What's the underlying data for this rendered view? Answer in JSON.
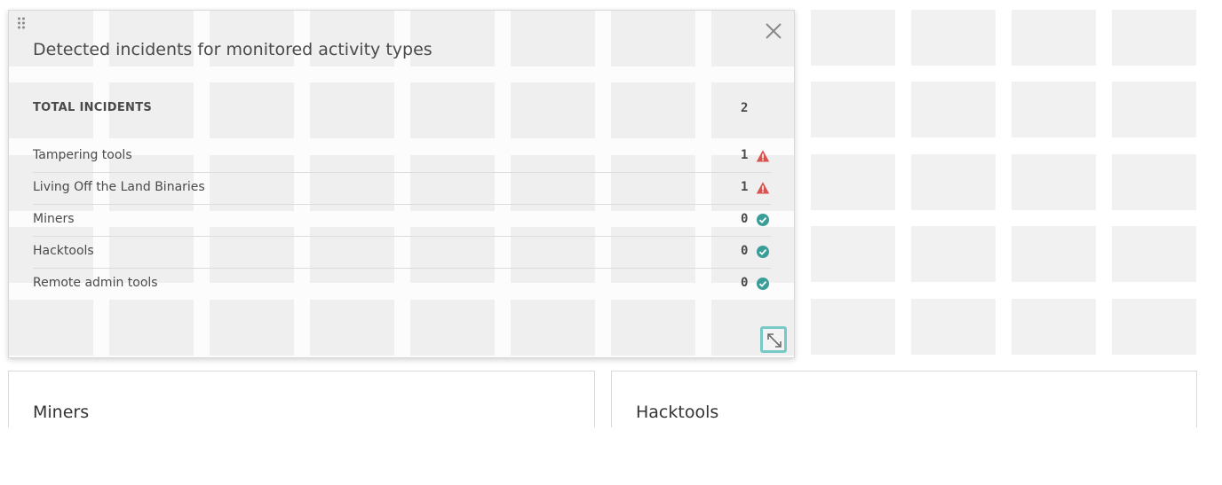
{
  "widget": {
    "title": "Detected incidents for monitored activity types",
    "total_label": "TOTAL INCIDENTS",
    "total_count": "2",
    "rows": [
      {
        "label": "Tampering tools",
        "count": "1",
        "status": "warning"
      },
      {
        "label": "Living Off the Land Binaries",
        "count": "1",
        "status": "warning"
      },
      {
        "label": "Miners",
        "count": "0",
        "status": "ok"
      },
      {
        "label": "Hacktools",
        "count": "0",
        "status": "ok"
      },
      {
        "label": "Remote admin tools",
        "count": "0",
        "status": "ok"
      }
    ],
    "icons": {
      "drag": "drag-handle-icon",
      "close": "close-icon",
      "resize": "resize-icon",
      "warning": "warning-triangle-icon",
      "ok": "check-circle-icon"
    }
  },
  "cards": [
    {
      "title": "Miners"
    },
    {
      "title": "Hacktools"
    }
  ],
  "colors": {
    "warning": "#d9534f",
    "ok": "#3a9e98",
    "resize_border": "#76c9c5",
    "grid_cell": "#f1f1f1"
  }
}
